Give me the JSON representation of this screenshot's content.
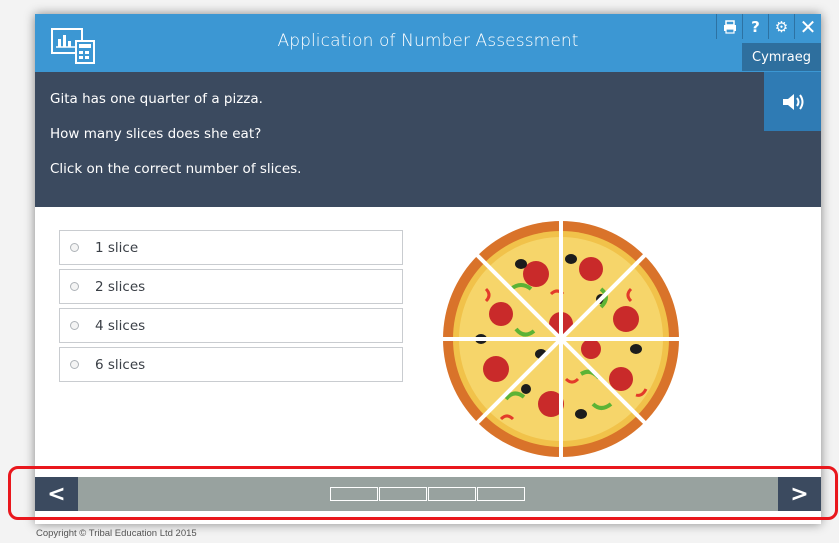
{
  "header": {
    "title": "Application of Number Assessment",
    "language_button": "Cymraeg",
    "tools": [
      {
        "name": "print-icon",
        "glyph": "🖶"
      },
      {
        "name": "help-icon",
        "glyph": "?"
      },
      {
        "name": "gear-icon",
        "glyph": "⚙"
      },
      {
        "name": "close-icon",
        "glyph": "✕"
      }
    ]
  },
  "question": {
    "lines": [
      "Gita has one quarter of a pizza.",
      "How many slices does she eat?",
      "Click on the correct number of slices."
    ],
    "audio_icon": "speaker-icon"
  },
  "options": [
    {
      "label": "1 slice"
    },
    {
      "label": "2 slices"
    },
    {
      "label": "4 slices"
    },
    {
      "label": "6 slices"
    }
  ],
  "footer": {
    "prev": "<",
    "next": ">",
    "progress_segments": 4
  },
  "copyright": "Copyright © Tribal Education Ltd 2015",
  "colors": {
    "header": "#3c97d3",
    "question_bg": "#3b4a5f",
    "footer": "#98a29f",
    "highlight": "#e9171d"
  }
}
